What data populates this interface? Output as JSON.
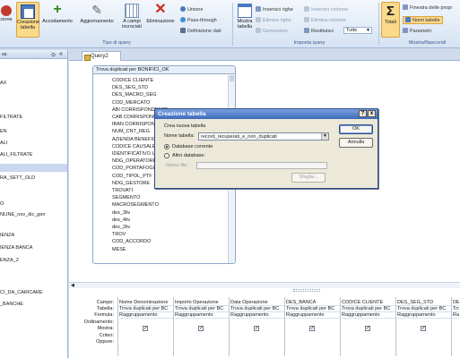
{
  "ribbon": {
    "buttons": [
      {
        "label": "cione",
        "name": "esecuzione-button"
      },
      {
        "label": "Creazione tabella",
        "name": "creazione-tabella-button"
      },
      {
        "label": "Accodamento",
        "name": "accodamento-button"
      },
      {
        "label": "Aggiornamento",
        "name": "aggiornamento-button"
      },
      {
        "label": "A campi incrociati",
        "name": "campi-incrociati-button"
      },
      {
        "label": "Eliminazione",
        "name": "eliminazione-button"
      }
    ],
    "small_items": {
      "unione": "Unione",
      "pass_through": "Pass-through",
      "definizione_dati": "Definizione dati",
      "mostra_tabella": "Mostra tabella",
      "inserisci_righe": "Inserisci righe",
      "elimina_righe": "Elimina righe",
      "generatore": "Generatore",
      "inserisci_colonne": "Inserisci colonne",
      "elimina_colonne": "Elimina colonne",
      "restituisci": "Restituisci",
      "restituisci_value": "Tutte",
      "totali": "Totali",
      "finestra_proprieta": "Finestra delle propr",
      "nomi_tabelle": "Nomi tabelle",
      "parametri": "Parametri"
    },
    "groups": {
      "tipo_query": "Tipo di query",
      "imposta_query": "Imposta query",
      "mostra_nascondi": "Mostra/Nascondi"
    }
  },
  "nav": {
    "header": "ss",
    "items": [
      "AX",
      "FILTRATE",
      "EN",
      "ALI",
      "ALI_FILTRATE",
      "",
      "RA_SETT_OLD",
      "O",
      "NLINE_nov_dic_gen",
      "",
      "IENZA",
      "IENZA BANCA",
      "ENZA_2",
      "",
      "CI_DA_CARICARE",
      "_BANCHE"
    ]
  },
  "tab": {
    "label": "Query2"
  },
  "table_window": {
    "title": "Trova duplicati per BONIFICI_OK",
    "fields": [
      "CODICE CLIENTE",
      "DES_SEG_STD",
      "DES_MACRO_SEG",
      "COD_MERCATO",
      "ABI CORRISPONDENTE",
      "CAB CORRISPONDENTE",
      "IBAN CORRISPONDENTE",
      "NUM_CNT_REG",
      "AZIENDA BENEFICIARIA",
      "CODICE CAUSALE",
      "IDENTIFICATIVO UNIVOCO",
      "NDG_OPERATORE",
      "COD_PORTAFOGLIO",
      "COD_TIPOL_PTF",
      "NDG_GESTORE",
      "TROVATI",
      "SEGMENTO",
      "MACROSEGMENTO",
      "des_3liv",
      "des_4liv",
      "des_2liv",
      "TROV",
      "COD_ACCORDO",
      "MESE"
    ]
  },
  "grid": {
    "row_headers": [
      "Campo:",
      "Tabella:",
      "Formula:",
      "Ordinamento:",
      "Mostra:",
      "Criteri:",
      "Oppure:"
    ],
    "columns": [
      {
        "campo": "Nome Denominazione",
        "tabella": "Trova duplicati per BC",
        "formula": "Raggruppamento"
      },
      {
        "campo": "Importo Operazione",
        "tabella": "Trova duplicati per BC",
        "formula": "Raggruppamento"
      },
      {
        "campo": "Data Operazione",
        "tabella": "Trova duplicati per BC",
        "formula": "Raggruppamento"
      },
      {
        "campo": "DES_BANCA",
        "tabella": "Trova duplicati per BC",
        "formula": "Raggruppamento"
      },
      {
        "campo": "CODICE CLIENTE",
        "tabella": "Trova duplicati per BC",
        "formula": "Raggruppamento"
      },
      {
        "campo": "DES_SEG_STD",
        "tabella": "Trova duplicati per BC",
        "formula": "Raggruppamento"
      },
      {
        "campo": "DE",
        "tabella": "Tro",
        "formula": "Ra"
      }
    ]
  },
  "dialog": {
    "title": "Creazione tabella",
    "help_label": "?",
    "close_label": "x",
    "section": "Crea nuova tabella",
    "name_label": "Nome tabella:",
    "name_value": "record_recuperati_e_non_duplicati",
    "radio_current": "Database corrente",
    "radio_other": "Altro database:",
    "file_label": "Nome file:",
    "ok": "OK",
    "cancel": "Annulla",
    "browse": "Sfoglia..."
  }
}
